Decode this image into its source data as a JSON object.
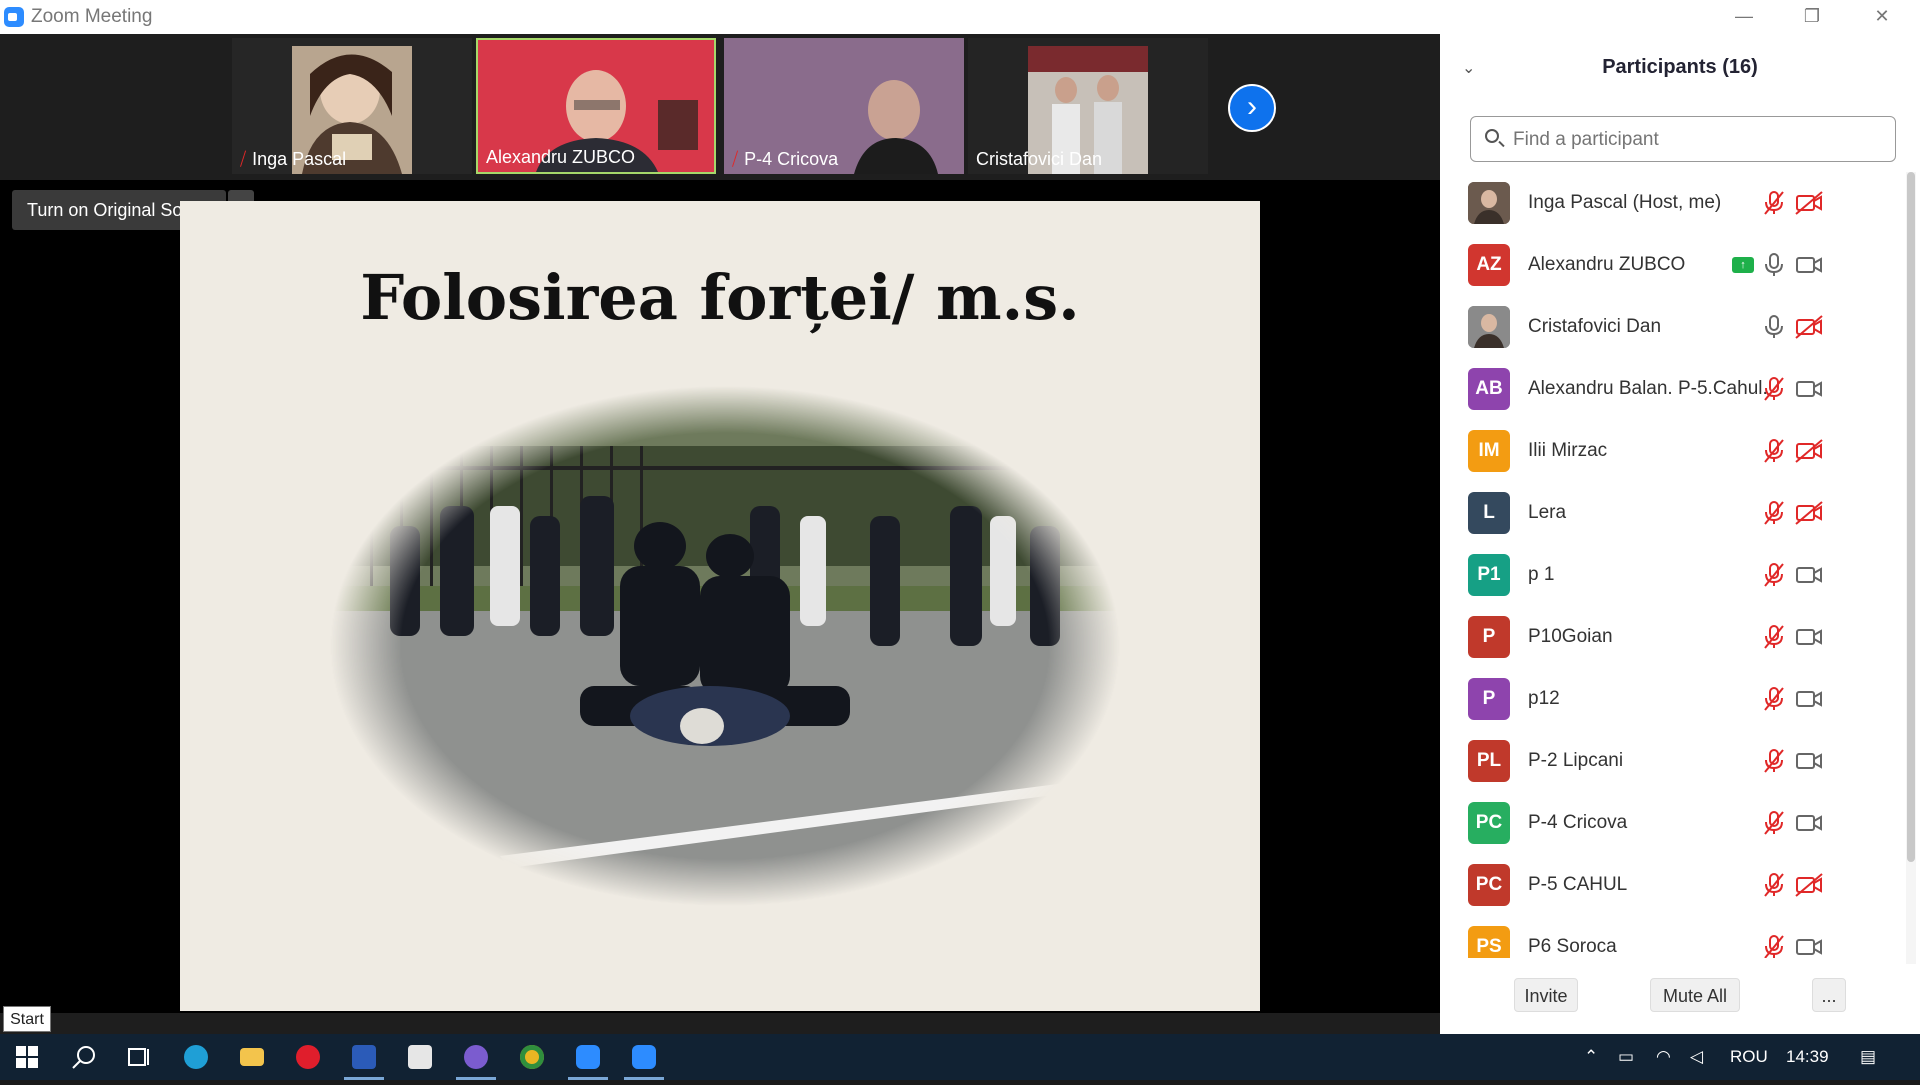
{
  "window": {
    "title": "Zoom Meeting",
    "minimize_glyph": "—",
    "restore_glyph": "❐",
    "close_glyph": "✕"
  },
  "video_strip": {
    "thumbnails": [
      {
        "name": "Inga Pascal",
        "muted": true
      },
      {
        "name": "Alexandru ZUBCO",
        "muted": false,
        "active_speaker": true
      },
      {
        "name": "P-4 Cricova",
        "muted": true
      },
      {
        "name": "Cristafovici Dan",
        "muted": false
      }
    ],
    "next_glyph": "›"
  },
  "original_sound": {
    "label": "Turn on Original Sound",
    "dropdown_glyph": "▾"
  },
  "slide": {
    "title": "Folosirea forței/ m.s."
  },
  "start_tooltip": "Start",
  "participants_panel": {
    "title": "Participants (16)",
    "collapse_glyph": "⌄",
    "search_placeholder": "Find a participant",
    "participants": [
      {
        "name": "Inga Pascal (Host, me)",
        "initials": "",
        "color": "#6b5a4e",
        "photo": true,
        "mic": "muted",
        "cam": "off"
      },
      {
        "name": "Alexandru ZUBCO",
        "initials": "AZ",
        "color": "#d1362f",
        "mic": "on",
        "cam": "on",
        "sharing": true
      },
      {
        "name": "Cristafovici Dan",
        "initials": "",
        "color": "#8a8a8a",
        "photo": true,
        "mic": "on",
        "cam": "off"
      },
      {
        "name": "Alexandru Balan. P-5.Cahul.",
        "initials": "AB",
        "color": "#8e44ad",
        "mic": "muted",
        "cam": "on"
      },
      {
        "name": "Ilii Mirzac",
        "initials": "IM",
        "color": "#f39c12",
        "mic": "muted",
        "cam": "off"
      },
      {
        "name": "Lera",
        "initials": "L",
        "color": "#34495e",
        "mic": "muted",
        "cam": "off"
      },
      {
        "name": "p 1",
        "initials": "P1",
        "color": "#16a085",
        "mic": "muted",
        "cam": "on"
      },
      {
        "name": "P10Goian",
        "initials": "P",
        "color": "#c0392b",
        "mic": "muted",
        "cam": "on"
      },
      {
        "name": "p12",
        "initials": "P",
        "color": "#8e44ad",
        "mic": "muted",
        "cam": "on"
      },
      {
        "name": "P-2 Lipcani",
        "initials": "PL",
        "color": "#c0392b",
        "mic": "muted",
        "cam": "on"
      },
      {
        "name": "P-4 Cricova",
        "initials": "PC",
        "color": "#27ae60",
        "mic": "muted",
        "cam": "on"
      },
      {
        "name": "P-5 CAHUL",
        "initials": "PC",
        "color": "#c0392b",
        "mic": "muted",
        "cam": "off"
      },
      {
        "name": "P6 Soroca",
        "initials": "PS",
        "color": "#f39c12",
        "mic": "muted",
        "cam": "on"
      }
    ],
    "buttons": {
      "invite": "Invite",
      "mute_all": "Mute All",
      "more": "..."
    }
  },
  "taskbar": {
    "language": "ROU",
    "time": "14:39"
  }
}
